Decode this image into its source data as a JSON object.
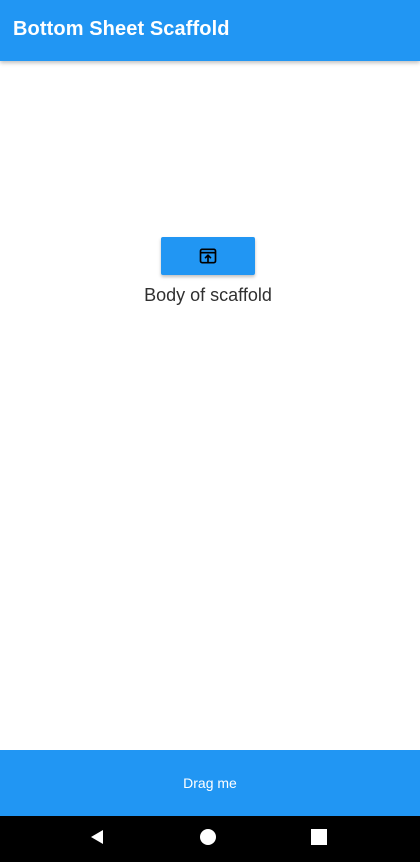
{
  "app_bar": {
    "title": "Bottom Sheet Scaffold",
    "color": "#2196F3"
  },
  "body": {
    "open_button_icon": "open-in-browser-icon",
    "text": "Body of scaffold"
  },
  "bottom_sheet": {
    "label": "Drag me",
    "color": "#2196F3"
  },
  "nav_bar": {
    "buttons": [
      "back-icon",
      "home-icon",
      "recents-icon"
    ],
    "color": "#000000"
  }
}
